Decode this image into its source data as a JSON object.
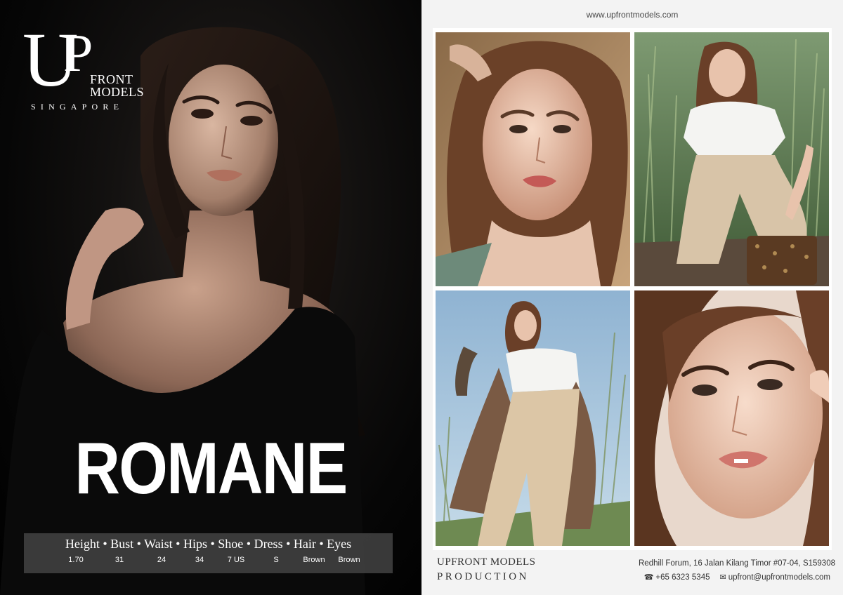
{
  "brand": {
    "logo_u": "U",
    "logo_p": "P",
    "logo_front": "FRONT",
    "logo_models": "MODELS",
    "logo_singapore": "SINGAPORE"
  },
  "model": {
    "name": "ROMANE"
  },
  "stats": {
    "labels_line": "Height • Bust • Waist • Hips • Shoe • Dress • Hair • Eyes",
    "values": {
      "height": "1.70",
      "bust": "31",
      "waist": "24",
      "hips": "34",
      "shoe": "7 US",
      "dress": "S",
      "hair": "Brown",
      "eyes": "Brown"
    }
  },
  "header": {
    "url": "www.upfrontmodels.com"
  },
  "footer": {
    "agency_name": "UPFRONT MODELS",
    "agency_sub": "PRODUCTION",
    "address": "Redhill Forum, 16 Jalan Kilang Timor #07-04, S159308",
    "phone_icon": "☎",
    "phone": "+65 6323 5345",
    "email_icon": "✉",
    "email": "upfront@upfrontmodels.com"
  },
  "colors": {
    "left_background": "#000000",
    "right_background": "#f3f3f3",
    "stats_panel": "#464646"
  },
  "icons": [
    "phone-icon",
    "email-icon"
  ]
}
